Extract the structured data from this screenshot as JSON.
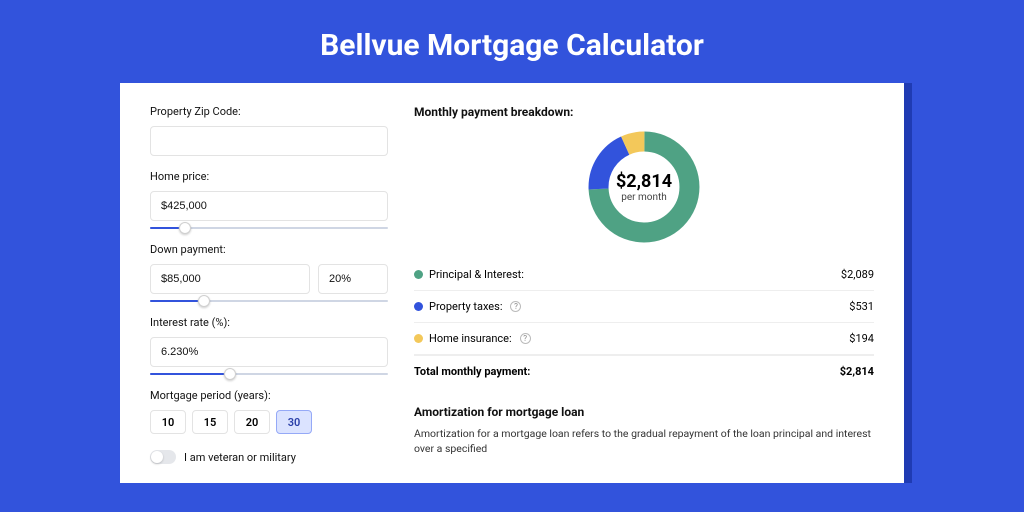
{
  "title": "Bellvue Mortgage Calculator",
  "form": {
    "zip_label": "Property Zip Code:",
    "zip_value": "",
    "home_price_label": "Home price:",
    "home_price_value": "$425,000",
    "down_payment_label": "Down payment:",
    "down_amount": "$85,000",
    "down_percent": "20%",
    "interest_label": "Interest rate (%):",
    "interest_value": "6.230%",
    "period_label": "Mortgage period (years):",
    "periods": [
      "10",
      "15",
      "20",
      "30"
    ],
    "period_active": "30",
    "veteran_label": "I am veteran or military"
  },
  "breakdown": {
    "title": "Monthly payment breakdown:",
    "center_value": "$2,814",
    "center_unit": "per month",
    "items": [
      {
        "label": "Principal & Interest:",
        "value": "$2,089",
        "color": "g",
        "help": false
      },
      {
        "label": "Property taxes:",
        "value": "$531",
        "color": "b",
        "help": true
      },
      {
        "label": "Home insurance:",
        "value": "$194",
        "color": "y",
        "help": true
      }
    ],
    "total_label": "Total monthly payment:",
    "total_value": "$2,814"
  },
  "amort": {
    "title": "Amortization for mortgage loan",
    "text": "Amortization for a mortgage loan refers to the gradual repayment of the loan principal and interest over a specified"
  },
  "chart_data": {
    "type": "pie",
    "title": "Monthly payment breakdown",
    "categories": [
      "Principal & Interest",
      "Property taxes",
      "Home insurance"
    ],
    "values": [
      2089,
      531,
      194
    ],
    "colors": [
      "#4fa284",
      "#3253dc",
      "#f3c85a"
    ],
    "total": 2814,
    "angles_deg": [
      267.2,
      67.9,
      24.8
    ]
  }
}
